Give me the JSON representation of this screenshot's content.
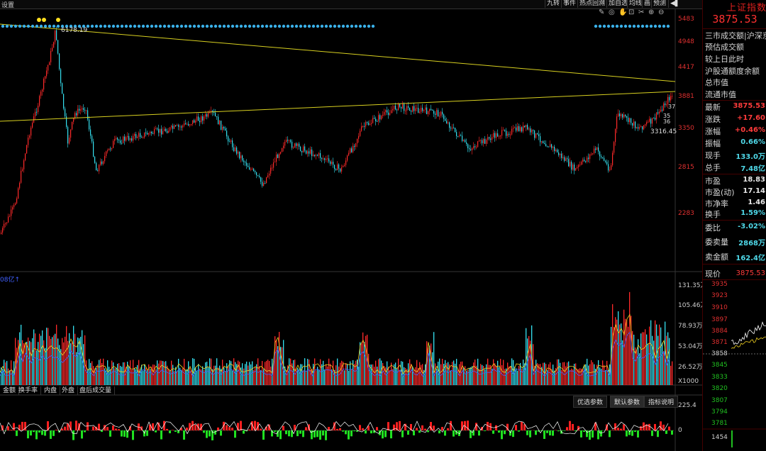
{
  "topbar": {
    "settings_label": "设置",
    "buttons": [
      "九转",
      "事件",
      "热点回溯",
      "加自选",
      "均线",
      "画",
      "预测"
    ],
    "tool_icons": [
      "✎",
      "◎",
      "✋",
      "⊡",
      "✂",
      "⊕",
      "⊖"
    ]
  },
  "chart": {
    "peak_label": "6178.19",
    "low_label": "3316.45",
    "mid_label": "37",
    "near_labels": [
      "35",
      "36"
    ],
    "price_axis": [
      "5483",
      "4948",
      "4417",
      "3881",
      "3350",
      "2815",
      "2283"
    ],
    "volume_label": "08亿↑",
    "volume_axis": [
      "131.35万",
      "105.46万",
      "78.93万",
      "53.04万",
      "26.52万",
      "X1000"
    ],
    "indicator_axis": [
      "225.4",
      "0"
    ],
    "colors": {
      "up": "#ff2a2a",
      "down": "#35e0f0",
      "trend": "#d8d020",
      "ma_white": "#ffffff",
      "ma_yellow": "#f0d020",
      "ma_blue": "#4060ff",
      "macd_up": "#ff2020",
      "macd_down": "#20e020"
    }
  },
  "bottom_tabs": [
    "金额",
    "换手率",
    "内盘",
    "外盘",
    "盘后成交量"
  ],
  "indicator_buttons": [
    "优选参数",
    "默认参数",
    "指标说明"
  ],
  "right_panel": {
    "title": "上证指数",
    "price": "3875.53",
    "info_rows": [
      "三市成交额|沪深京",
      "预估成交额",
      "较上日此时",
      "沪股通额度余额",
      "总市值",
      "流通市值"
    ],
    "quotes": [
      {
        "label": "最新",
        "value": "3875.53",
        "color": "red"
      },
      {
        "label": "涨跌",
        "value": "+17.60",
        "color": "red"
      },
      {
        "label": "涨幅",
        "value": "+0.46%",
        "color": "red"
      },
      {
        "label": "振幅",
        "value": "0.66%",
        "color": "cyan"
      },
      {
        "label": "现手",
        "value": "133.0万",
        "color": "cyan"
      },
      {
        "label": "总手",
        "value": "7.48亿",
        "color": "cyan"
      },
      {
        "label": "市盈",
        "value": "18.83",
        "color": "white"
      },
      {
        "label": "市盈(动)",
        "value": "17.14",
        "color": "white"
      },
      {
        "label": "市净率",
        "value": "1.46",
        "color": "white"
      },
      {
        "label": "换手",
        "value": "1.59%",
        "color": "cyan"
      },
      {
        "label": "委比",
        "value": "-3.02%",
        "color": "cyan"
      },
      {
        "label": "委卖量",
        "value": "2868万",
        "color": "cyan"
      },
      {
        "label": "卖金额",
        "value": "162.4亿",
        "color": "cyan"
      }
    ],
    "current_label": "现价",
    "current_value": "3875.53",
    "mini_axis": [
      "3935",
      "3923",
      "3910",
      "3897",
      "3884",
      "3871",
      "3858",
      "3845",
      "3833",
      "3820",
      "3807",
      "3794",
      "3781"
    ],
    "mini_volume": "1454"
  }
}
